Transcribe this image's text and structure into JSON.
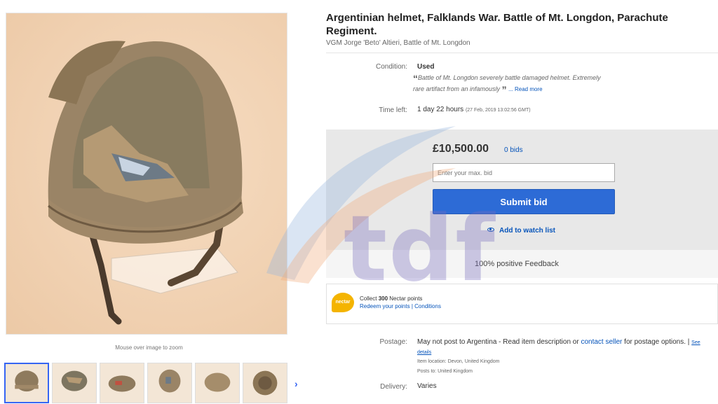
{
  "gallery": {
    "zoom_hint": "Mouse over image to zoom",
    "thumbnail_count": 6,
    "next_icon": "chevron-right-icon"
  },
  "listing": {
    "title": "Argentinian helmet, Falklands War. Battle of Mt. Longdon, Parachute Regiment.",
    "subtitle": "VGM Jorge 'Beto' Altieri, Battle of Mt. Longdon"
  },
  "condition": {
    "label": "Condition:",
    "value": "Used",
    "quote": "Battle of Mt. Longdon severely battle damaged helmet. Extremely rare artifact from an infamously",
    "read_more": "... Read more"
  },
  "time_left": {
    "label": "Time left:",
    "value": "1 day 22 hours",
    "detail": "(27 Feb, 2019   13:02:56 GMT)"
  },
  "bid": {
    "price": "£10,500.00",
    "bids": "0 bids",
    "input_placeholder": "Enter your max. bid",
    "submit_label": "Submit bid",
    "watch_label": "Add to watch list"
  },
  "feedback": "100% positive Feedback",
  "nectar": {
    "logo": "nectar",
    "collect_prefix": "Collect",
    "points": "300",
    "collect_suffix": "Nectar points",
    "redeem": "Redeem your points",
    "separator": "|",
    "conditions": "Conditions"
  },
  "postage": {
    "label": "Postage:",
    "text_a": "May not post to Argentina - Read item description or",
    "link": "contact seller",
    "text_b": "for postage options.",
    "see_details": "See details",
    "item_location": "Item location:  Devon, United Kingdom",
    "posts_to": "Posts to:  United Kingdom"
  },
  "delivery": {
    "label": "Delivery:",
    "value": "Varies"
  },
  "watermark": "tdf",
  "colors": {
    "link": "#0654ba",
    "button": "#2d6bd6",
    "bid_panel": "#e8e8e8",
    "nectar": "#f4b400"
  }
}
